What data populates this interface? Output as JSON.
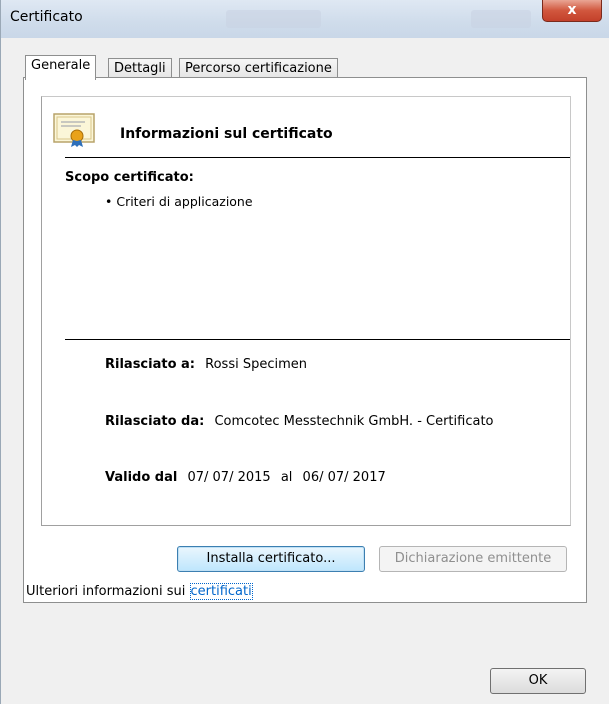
{
  "window": {
    "title": "Certificato",
    "close_label": "x"
  },
  "tabs": [
    {
      "label": "Generale",
      "active": true
    },
    {
      "label": "Dettagli",
      "active": false
    },
    {
      "label": "Percorso certificazione",
      "active": false
    }
  ],
  "info": {
    "heading": "Informazioni sul certificato",
    "scope_title": "Scopo certificato:",
    "scope_items": [
      "• Criteri di applicazione"
    ],
    "issued_to_label": "Rilasciato a:",
    "issued_to_value": "Rossi Specimen",
    "issued_by_label": "Rilasciato da:",
    "issued_by_value": "Comcotec Messtechnik GmbH. - Certificato",
    "valid_from_label": "Valido dal",
    "valid_from_value": "07/ 07/ 2015",
    "valid_to_label": "al",
    "valid_to_value": "06/ 07/ 2017"
  },
  "buttons": {
    "install": "Installa certificato...",
    "issuer_statement": "Dichiarazione emittente",
    "ok": "OK"
  },
  "more_info": {
    "text": "Ulteriori informazioni sui",
    "link": "certificati"
  },
  "colors": {
    "link": "#0066cc",
    "close_button": "#c94530",
    "titlebar": "#cfdceb"
  },
  "icons": [
    "certificate-icon",
    "close-icon"
  ]
}
